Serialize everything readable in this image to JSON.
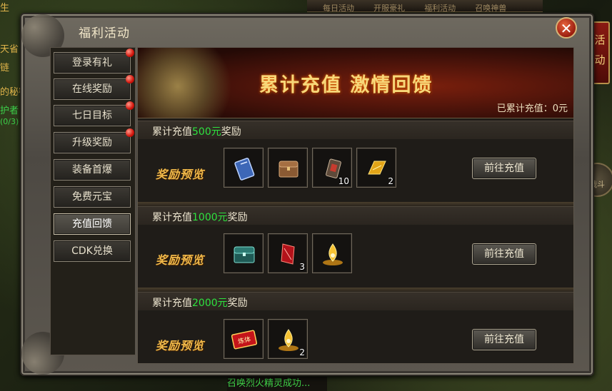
{
  "window": {
    "title": "福利活动",
    "close_symbol": "✕"
  },
  "sidebar": {
    "tabs": [
      {
        "label": "登录有礼",
        "has_dot": true
      },
      {
        "label": "在线奖励",
        "has_dot": true
      },
      {
        "label": "七日目标",
        "has_dot": true
      },
      {
        "label": "升级奖励",
        "has_dot": true
      },
      {
        "label": "装备首爆",
        "has_dot": false
      },
      {
        "label": "免费元宝",
        "has_dot": false
      },
      {
        "label": "充值回馈",
        "has_dot": false,
        "active": true
      },
      {
        "label": "CDK兑换",
        "has_dot": false
      }
    ]
  },
  "banner": {
    "title": "累计充值  激情回馈",
    "recharged_text": "已累计充值：0元"
  },
  "tiers": [
    {
      "prefix": "累计充值",
      "amount": "500元",
      "suffix": "奖励",
      "preview_label": "奖励预览",
      "items": [
        {
          "icon": "blue-book-icon",
          "count": ""
        },
        {
          "icon": "wooden-chest-icon",
          "count": ""
        },
        {
          "icon": "scroll-icon",
          "count": "10"
        },
        {
          "icon": "gold-ingot-icon",
          "count": "2"
        }
      ],
      "button_label": "前往充值"
    },
    {
      "prefix": "累计充值",
      "amount": "1000元",
      "suffix": "奖励",
      "preview_label": "奖励预览",
      "items": [
        {
          "icon": "jade-chest-icon",
          "count": ""
        },
        {
          "icon": "red-crystal-icon",
          "count": "3"
        },
        {
          "icon": "golden-flame-icon",
          "count": ""
        }
      ],
      "button_label": "前往充值"
    },
    {
      "prefix": "累计充值",
      "amount": "2000元",
      "suffix": "奖励",
      "preview_label": "奖励预览",
      "items": [
        {
          "icon": "refine-talisman-icon",
          "count": "",
          "text": "炼体"
        },
        {
          "icon": "golden-flame-icon",
          "count": "2"
        }
      ],
      "button_label": "前往充值"
    }
  ],
  "hud": {
    "side_tab": "活动",
    "war_button": "战斗",
    "bottom_message": "召唤烈火精灵成功...",
    "left_texts": [
      "生",
      "天省",
      "链",
      "的秘密",
      "护者",
      "(0/3)"
    ],
    "top_bar": [
      "每日活动",
      "开服豪礼",
      "福利活动",
      "召唤神兽"
    ]
  }
}
